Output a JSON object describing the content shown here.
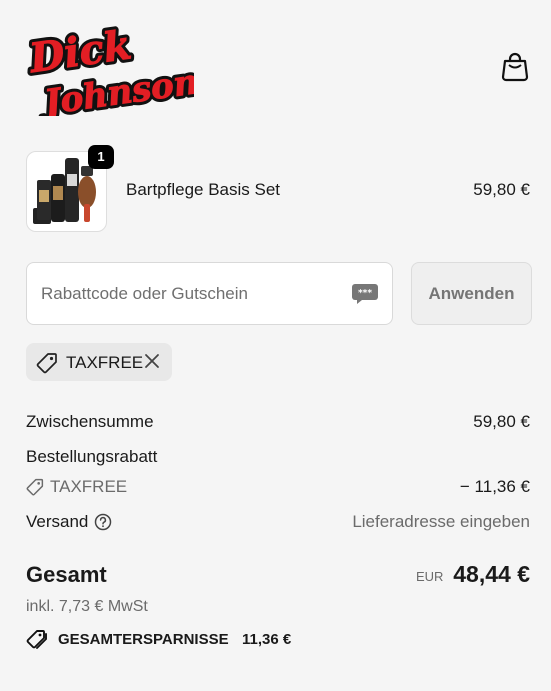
{
  "brand": {
    "logo_text": "Dick Johnson"
  },
  "header": {
    "cart_icon": "shopping-bag-icon"
  },
  "cart_item": {
    "quantity": "1",
    "name": "Bartpflege Basis Set",
    "price": "59,80 €"
  },
  "discount": {
    "placeholder": "Rabattcode oder Gutschein",
    "value": "",
    "apply_label": "Anwenden",
    "applied_code": "TAXFREE"
  },
  "summary": {
    "subtotal_label": "Zwischensumme",
    "subtotal_value": "59,80 €",
    "order_discount_label": "Bestellungsrabatt",
    "discount_code": "TAXFREE",
    "discount_value": "− 11,36 €",
    "shipping_label": "Versand",
    "shipping_value": "Lieferadresse eingeben",
    "total_label": "Gesamt",
    "currency": "EUR",
    "total_value": "48,44 €",
    "tax_note": "inkl. 7,73 € MwSt",
    "savings_label": "GESAMTERSPARNISSE",
    "savings_value": "11,36 €"
  },
  "colors": {
    "logo_red": "#e31e24",
    "background": "#f5f5f5",
    "badge": "#000000"
  }
}
